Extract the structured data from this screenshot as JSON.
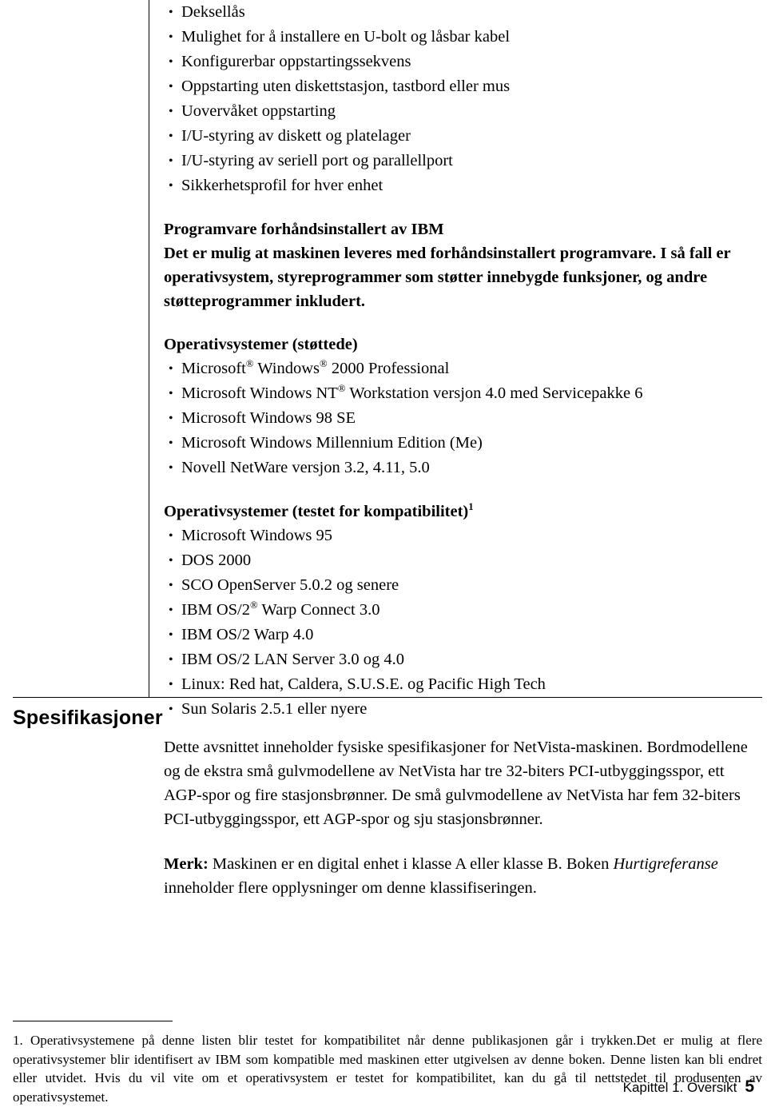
{
  "features": {
    "items": [
      "Deksellås",
      "Mulighet for å installere en U-bolt og låsbar kabel",
      "Konfigurerbar oppstartingssekvens",
      "Oppstarting uten diskettstasjon, tastbord eller mus",
      "Uovervåket oppstarting",
      "I/U-styring av diskett og platelager",
      "I/U-styring av seriell port og parallellport",
      "Sikkerhetsprofil for hver enhet"
    ]
  },
  "software": {
    "heading": "Programvare forhåndsinstallert av IBM",
    "paragraph": "Det er mulig at maskinen leveres med forhåndsinstallert programvare. I så fall er operativsystem, styreprogrammer som støtter innebygde funksjoner, og andre støtteprogrammer inkludert."
  },
  "os_supported": {
    "heading": "Operativsystemer (støttede)",
    "items": [
      {
        "pre": "Microsoft",
        "sup1": "®",
        "mid": " Windows",
        "sup2": "®",
        "post": " 2000 Professional"
      },
      {
        "pre": "Microsoft Windows NT",
        "sup1": "®",
        "mid": "",
        "sup2": "",
        "post": " Workstation versjon 4.0 med Servicepakke 6"
      },
      {
        "pre": "Microsoft Windows 98 SE",
        "sup1": "",
        "mid": "",
        "sup2": "",
        "post": ""
      },
      {
        "pre": "Microsoft Windows Millennium Edition (Me)",
        "sup1": "",
        "mid": "",
        "sup2": "",
        "post": ""
      },
      {
        "pre": "Novell NetWare versjon 3.2, 4.11, 5.0",
        "sup1": "",
        "mid": "",
        "sup2": "",
        "post": ""
      }
    ]
  },
  "os_tested": {
    "heading": "Operativsystemer (testet for kompatibilitet)",
    "heading_sup": "1",
    "items": [
      {
        "pre": "Microsoft Windows 95",
        "sup1": "",
        "post": ""
      },
      {
        "pre": "DOS 2000",
        "sup1": "",
        "post": ""
      },
      {
        "pre": "SCO OpenServer 5.0.2 og senere",
        "sup1": "",
        "post": ""
      },
      {
        "pre": "IBM OS/2",
        "sup1": "®",
        "post": " Warp Connect 3.0"
      },
      {
        "pre": "IBM OS/2 Warp 4.0",
        "sup1": "",
        "post": ""
      },
      {
        "pre": "IBM OS/2 LAN Server 3.0 og 4.0",
        "sup1": "",
        "post": ""
      },
      {
        "pre": "Linux: Red hat, Caldera, S.U.S.E. og Pacific High Tech",
        "sup1": "",
        "post": ""
      },
      {
        "pre": "Sun Solaris 2.5.1 eller nyere",
        "sup1": "",
        "post": ""
      }
    ]
  },
  "specifications": {
    "title": "Spesifikasjoner",
    "paragraph": "Dette avsnittet inneholder fysiske spesifikasjoner for NetVista-maskinen. Bordmodellene og de ekstra små gulvmodellene av NetVista har tre 32-biters PCI-utbyggingsspor, ett AGP-spor og fire stasjonsbrønner. De små gulvmodellene av NetVista har fem 32-biters PCI-utbyggingsspor, ett AGP-spor og sju stasjonsbrønner.",
    "note_label": "Merk:",
    "note_text_1": " Maskinen er en digital enhet i klasse A eller klasse B. Boken ",
    "note_italic": "Hurtigreferanse",
    "note_text_2": " inneholder flere opplysninger om denne klassifiseringen."
  },
  "footnote": {
    "number": "1.",
    "text": " Operativsystemene på denne listen blir testet for kompatibilitet når denne publikasjonen går i trykken.Det er mulig at flere operativsystemer blir identifisert av IBM som kompatible med maskinen etter utgivelsen av denne boken. Denne listen kan bli endret eller utvidet. Hvis du vil vite om et operativsystem er testet for kompatibilitet, kan du gå til nettstedet til produsenten av operativsystemet."
  },
  "footer": {
    "chapter": "Kapittel 1. Oversikt",
    "page": "5"
  }
}
